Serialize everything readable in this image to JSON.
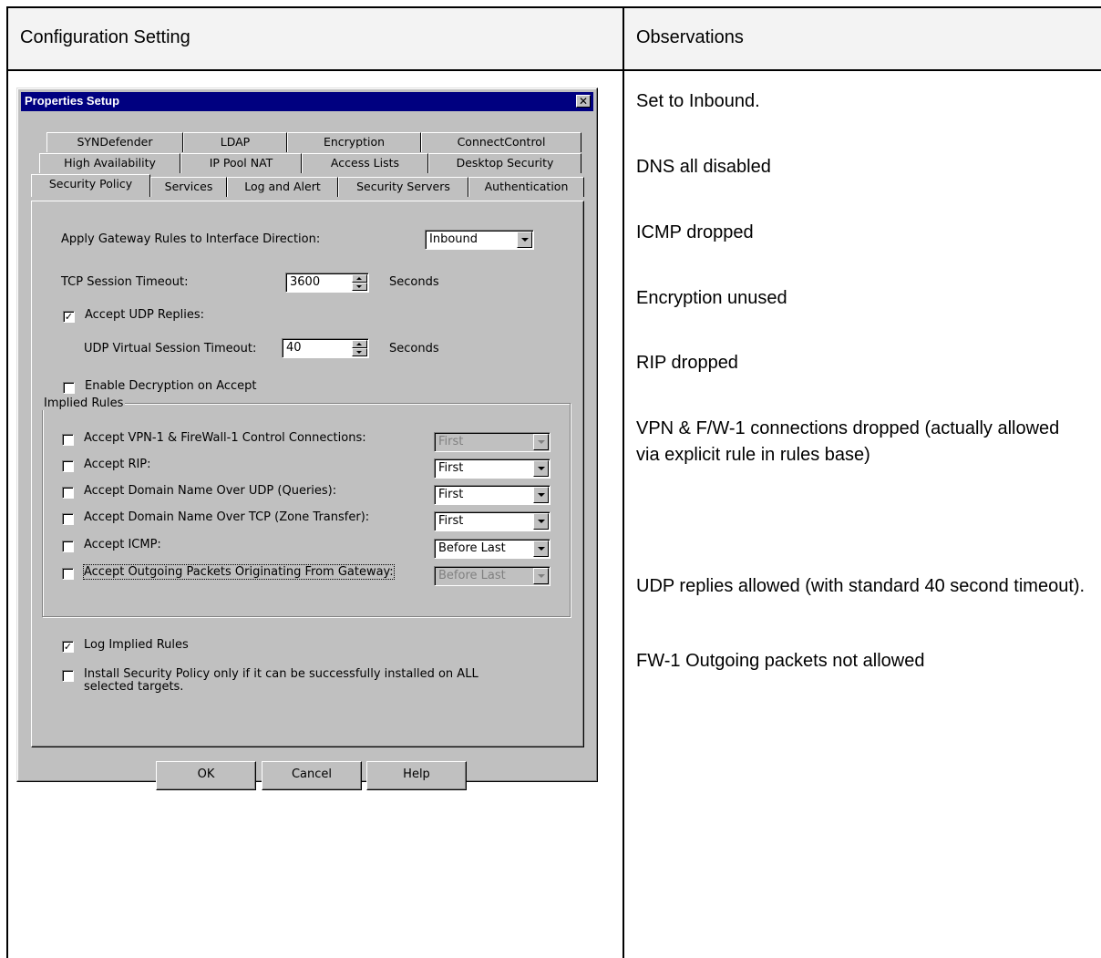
{
  "table": {
    "header_left": "Configuration Setting",
    "header_right": "Observations"
  },
  "observations": [
    "Set to Inbound.",
    "DNS all disabled",
    "ICMP dropped",
    "Encryption unused",
    "RIP dropped",
    "VPN & F/W-1 connections dropped (actually allowed via explicit rule in rules base)",
    "UDP replies allowed (with standard 40 second timeout).",
    "FW-1 Outgoing packets not allowed"
  ],
  "dialog": {
    "title": "Properties Setup",
    "close_icon": "close-icon",
    "tabs_row1": [
      "SYNDefender",
      "LDAP",
      "Encryption",
      "ConnectControl"
    ],
    "tabs_row2": [
      "High Availability",
      "IP Pool NAT",
      "Access Lists",
      "Desktop Security"
    ],
    "tabs_row3": [
      "Security Policy",
      "Services",
      "Log and Alert",
      "Security Servers",
      "Authentication"
    ],
    "active_tab": "Security Policy",
    "gateway_direction": {
      "label": "Apply Gateway Rules to Interface Direction:",
      "value": "Inbound"
    },
    "tcp_timeout": {
      "label": "TCP Session Timeout:",
      "value": "3600",
      "unit": "Seconds"
    },
    "accept_udp": {
      "label": "Accept UDP Replies:",
      "checked": true
    },
    "udp_timeout": {
      "label": "UDP Virtual Session Timeout:",
      "value": "40",
      "unit": "Seconds"
    },
    "decryption": {
      "label": "Enable Decryption on Accept",
      "checked": false
    },
    "implied_rules": {
      "title": "Implied Rules",
      "rules": [
        {
          "label": "Accept VPN-1 & FireWall-1 Control Connections:",
          "checked": false,
          "value": "First",
          "disabled": true
        },
        {
          "label": "Accept RIP:",
          "checked": false,
          "value": "First",
          "disabled": false
        },
        {
          "label": "Accept Domain Name Over UDP (Queries):",
          "checked": false,
          "value": "First",
          "disabled": false
        },
        {
          "label": "Accept Domain Name Over TCP (Zone Transfer):",
          "checked": false,
          "value": "First",
          "disabled": false
        },
        {
          "label": "Accept ICMP:",
          "checked": false,
          "value": "Before Last",
          "disabled": false
        },
        {
          "label": "Accept Outgoing Packets Originating From Gateway:",
          "checked": false,
          "value": "Before Last",
          "disabled": true
        }
      ]
    },
    "log_implied": {
      "label": "Log Implied Rules",
      "checked": true
    },
    "install_policy": {
      "label_line1": "Install Security Policy only if it can be successfully installed on ALL",
      "label_line2": "selected targets.",
      "checked": false
    },
    "buttons": {
      "ok": "OK",
      "cancel": "Cancel",
      "help": "Help"
    }
  }
}
